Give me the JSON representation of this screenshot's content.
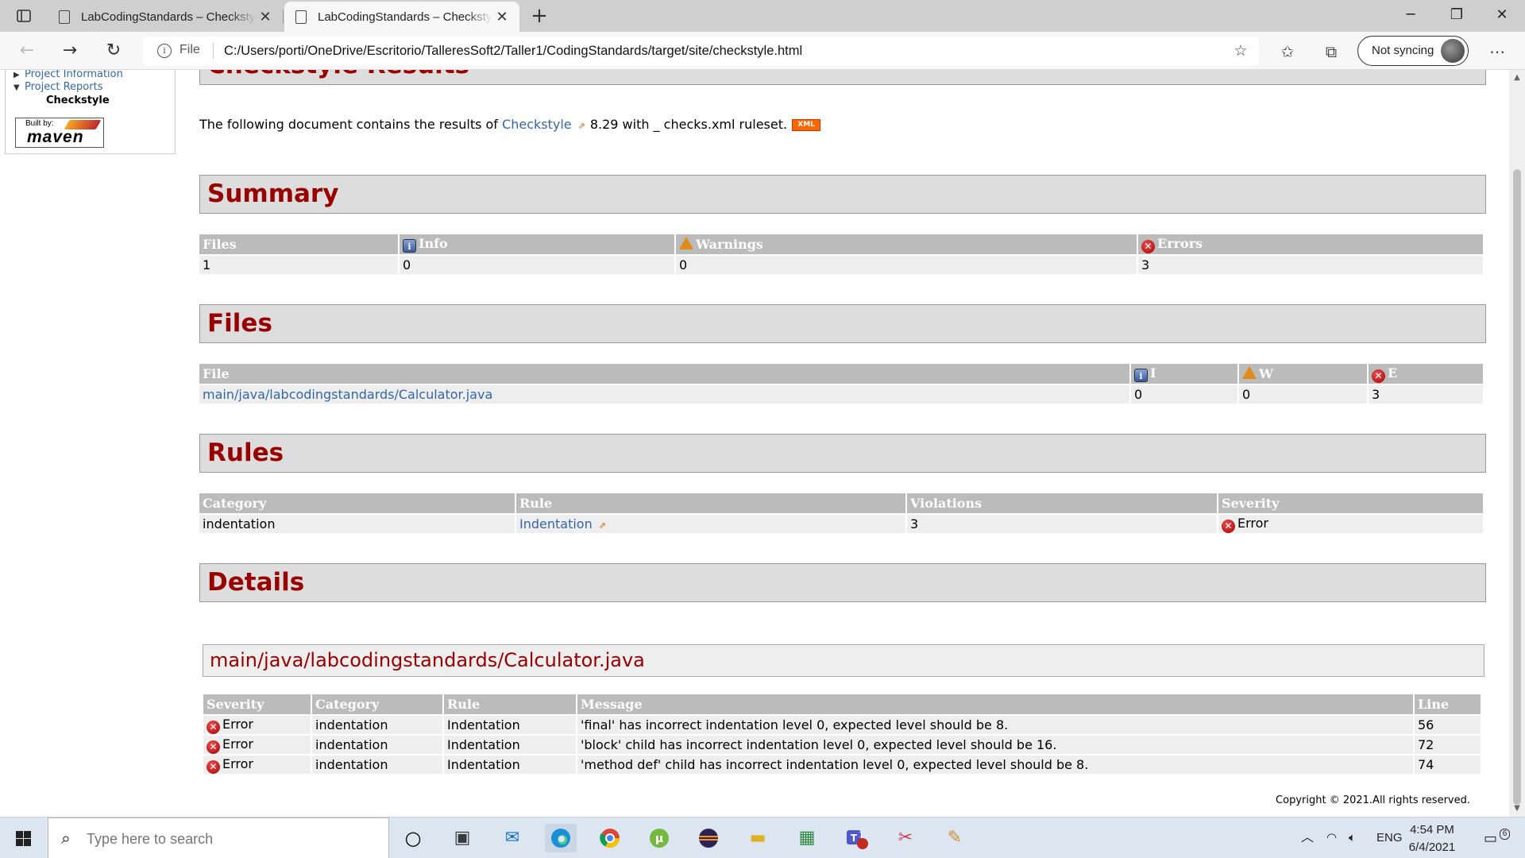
{
  "browser": {
    "tabs": [
      {
        "title": "LabCodingStandards – Checkstyle Results"
      },
      {
        "title": "LabCodingStandards – Checkstyle Results"
      }
    ],
    "address": {
      "scheme": "File",
      "url": "C:/Users/porti/OneDrive/Escritorio/TalleresSoft2/Taller1/CodingStandards/target/site/checkstyle.html"
    },
    "sync_label": "Not syncing"
  },
  "sidebar": {
    "items": [
      {
        "label": "Project Information"
      },
      {
        "label": "Project Reports"
      },
      {
        "label": "Checkstyle"
      }
    ],
    "badge": {
      "line1": "Built by:",
      "line2": "maven"
    }
  },
  "page": {
    "title": "Checkstyle Results",
    "intro": {
      "before": "The following document contains the results of ",
      "link": "Checkstyle",
      "after": "8.29 with _ checks.xml ruleset.",
      "xml_badge": "XML"
    },
    "summary": {
      "heading": "Summary",
      "headers": {
        "files": "Files",
        "info": "Info",
        "warnings": "Warnings",
        "errors": "Errors"
      },
      "row": {
        "files": "1",
        "info": "0",
        "warnings": "0",
        "errors": "3"
      }
    },
    "files": {
      "heading": "Files",
      "headers": {
        "file": "File",
        "i": "I",
        "w": "W",
        "e": "E"
      },
      "rows": [
        {
          "file": "main/java/labcodingstandards/Calculator.java",
          "i": "0",
          "w": "0",
          "e": "3"
        }
      ]
    },
    "rules": {
      "heading": "Rules",
      "headers": {
        "category": "Category",
        "rule": "Rule",
        "violations": "Violations",
        "severity": "Severity"
      },
      "rows": [
        {
          "category": "indentation",
          "rule": "Indentation",
          "violations": "3",
          "severity": "Error"
        }
      ]
    },
    "details": {
      "heading": "Details",
      "file_heading": "main/java/labcodingstandards/Calculator.java",
      "headers": {
        "severity": "Severity",
        "category": "Category",
        "rule": "Rule",
        "message": "Message",
        "line": "Line"
      },
      "rows": [
        {
          "severity": "Error",
          "category": "indentation",
          "rule": "Indentation",
          "message": "'final' has incorrect indentation level 0, expected level should be 8.",
          "line": "56"
        },
        {
          "severity": "Error",
          "category": "indentation",
          "rule": "Indentation",
          "message": "'block' child has incorrect indentation level 0, expected level should be 16.",
          "line": "72"
        },
        {
          "severity": "Error",
          "category": "indentation",
          "rule": "Indentation",
          "message": "'method def' child has incorrect indentation level 0, expected level should be 8.",
          "line": "74"
        }
      ]
    },
    "copyright": "Copyright © 2021.All rights reserved."
  },
  "taskbar": {
    "search_placeholder": "Type here to search",
    "language": "ENG",
    "time": "4:54 PM",
    "date": "6/4/2021",
    "teams_badge": "1",
    "notifications": "6"
  },
  "colors": {
    "heading": "#990000",
    "link": "#3366aa",
    "table_header": "#bbbbbb",
    "table_cell": "#eeeeee"
  }
}
